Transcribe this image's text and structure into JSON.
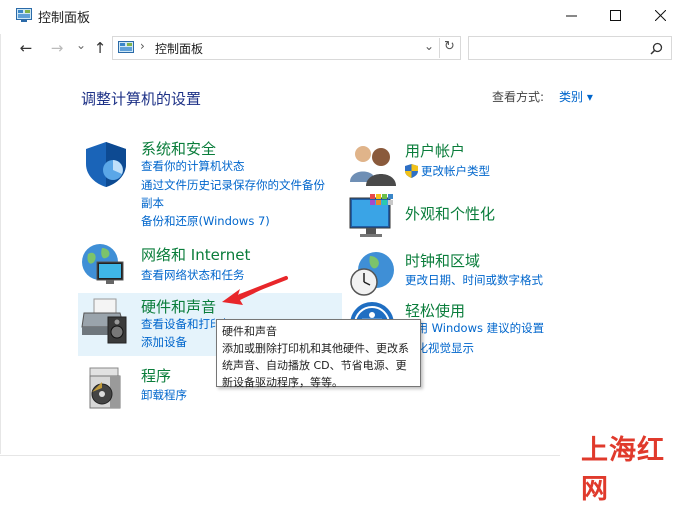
{
  "window": {
    "title": "控制面板",
    "minimize_glyph": "─",
    "maximize_glyph": "☐",
    "close_glyph": "✕"
  },
  "nav": {
    "back_glyph": "←",
    "forward_glyph": "→",
    "dropdown_glyph": "⌄",
    "up_glyph": "↑",
    "breadcrumb_sep": "›",
    "breadcrumb": "控制面板",
    "refresh_glyph": "↻",
    "search_placeholder": ""
  },
  "main": {
    "heading": "调整计算机的设置",
    "view_label": "查看方式:",
    "view_value": "类别 ▾"
  },
  "categories": {
    "system": {
      "title": "系统和安全",
      "links": [
        "查看你的计算机状态",
        "通过文件历史记录保存你的文件备份副本",
        "备份和还原(Windows 7)"
      ]
    },
    "network": {
      "title": "网络和 Internet",
      "links": [
        "查看网络状态和任务"
      ]
    },
    "hardware": {
      "title": "硬件和声音",
      "links": [
        "查看设备和打印机",
        "添加设备"
      ]
    },
    "programs": {
      "title": "程序",
      "links": [
        "卸载程序"
      ]
    },
    "accounts": {
      "title": "用户帐户",
      "links": [
        "更改帐户类型"
      ]
    },
    "appearance": {
      "title": "外观和个性化",
      "links": []
    },
    "clock": {
      "title": "时钟和区域",
      "links": [
        "更改日期、时间或数字格式"
      ]
    },
    "ease": {
      "title": "轻松使用",
      "links": [
        "使用 Windows 建议的设置",
        "优化视觉显示"
      ]
    }
  },
  "tooltip": {
    "title": "硬件和声音",
    "body": "添加或删除打印机和其他硬件、更改系统声音、自动播放 CD、节省电源、更新设备驱动程序，等等。"
  },
  "watermark": "上海红网",
  "colors": {
    "category_title": "#0a7d3b",
    "link": "#0066cc",
    "heading": "#1e3287",
    "highlight": "#e5f3fb",
    "arrow": "#e8262a",
    "watermark": "#e03a2c"
  }
}
